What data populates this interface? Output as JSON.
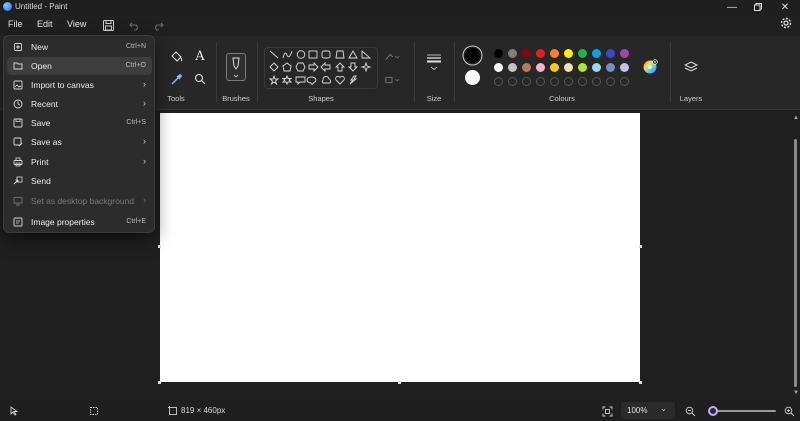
{
  "window": {
    "title": "Untitled - Paint"
  },
  "menubar": {
    "file": "File",
    "edit": "Edit",
    "view": "View"
  },
  "ribbon": {
    "tools_label": "Tools",
    "brushes_label": "Brushes",
    "shapes_label": "Shapes",
    "size_label": "Size",
    "colours_label": "Colours",
    "layers_label": "Layers"
  },
  "colors": {
    "primary": "#000000",
    "secondary": "#ffffff",
    "row1": [
      "#000000",
      "#7f7f7f",
      "#880015",
      "#ed1c24",
      "#ff7f27",
      "#fff200",
      "#22b14c",
      "#00a2e8",
      "#3f48cc",
      "#a349a4"
    ],
    "row2": [
      "#ffffff",
      "#c3c3c3",
      "#b97a57",
      "#ffaec9",
      "#ffc90e",
      "#efe4b0",
      "#b5e61d",
      "#99d9ea",
      "#7092be",
      "#c8bfe7"
    ]
  },
  "file_menu": {
    "items": [
      {
        "label": "New",
        "shortcut": "Ctrl+N",
        "icon": "new-file-icon"
      },
      {
        "label": "Open",
        "shortcut": "Ctrl+O",
        "icon": "folder-open-icon"
      },
      {
        "label": "Import to canvas",
        "icon": "import-icon"
      },
      {
        "label": "Recent",
        "icon": "clock-icon"
      },
      {
        "label": "Save",
        "shortcut": "Ctrl+S",
        "icon": "save-icon"
      },
      {
        "label": "Save as",
        "icon": "save-as-icon"
      },
      {
        "label": "Print",
        "icon": "print-icon"
      },
      {
        "label": "Send",
        "icon": "send-icon"
      },
      {
        "label": "Set as desktop background",
        "icon": "desktop-icon",
        "disabled": true
      },
      {
        "label": "Image properties",
        "shortcut": "Ctrl+E",
        "icon": "properties-icon"
      }
    ]
  },
  "status": {
    "canvas_size": "819 × 460px",
    "zoom": "100%"
  }
}
